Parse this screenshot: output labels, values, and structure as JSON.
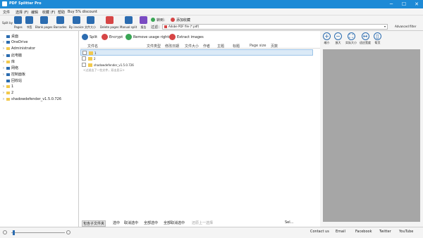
{
  "window": {
    "title": "PDF Splitter Pro",
    "minimize": "─",
    "maximize": "☐",
    "close": "✕"
  },
  "menu": [
    "文件",
    "选择 (F)",
    "编辑",
    "收藏 (F)",
    "帮助",
    "Buy 5% discount"
  ],
  "toolbar": {
    "split_by": "Split by",
    "buttons": [
      {
        "label": "Pages",
        "color": "#2b6cb0"
      },
      {
        "label": "书签",
        "color": "#2b6cb0"
      },
      {
        "label": "Blank pages",
        "color": "#2b6cb0"
      },
      {
        "label": "Barcodes",
        "color": "#2b6cb0"
      },
      {
        "label": "By invoice",
        "color": "#2b6cb0"
      },
      {
        "label": "文件大小",
        "color": "#2b6cb0"
      },
      {
        "label": "Delete pages",
        "color": "#d64545"
      },
      {
        "label": "Manual split",
        "color": "#2b6cb0"
      },
      {
        "label": "报告",
        "color": "#7a4bc2"
      }
    ],
    "goto_label": "转到：",
    "add_fav_label": "添加收藏",
    "filter_label": "过滤：",
    "filter_value": "Adobe PDF file (*.pdf)",
    "advanced_filter": "Advanced filter"
  },
  "tree": [
    {
      "label": "桌面",
      "arrow": "",
      "color": "#2b6cb0"
    },
    {
      "label": "OneDrive",
      "arrow": "›",
      "color": "#2b6cb0"
    },
    {
      "label": "Administrator",
      "arrow": "›",
      "color": "#f2c94c"
    },
    {
      "label": "此电脑",
      "arrow": "›",
      "color": "#2b6cb0"
    },
    {
      "label": "库",
      "arrow": "›",
      "color": "#f2c94c"
    },
    {
      "label": "网络",
      "arrow": "›",
      "color": "#2b6cb0"
    },
    {
      "label": "控制面板",
      "arrow": "›",
      "color": "#2b6cb0"
    },
    {
      "label": "回收站",
      "arrow": "",
      "color": "#2b6cb0"
    },
    {
      "label": "1",
      "arrow": "›",
      "color": "#f2c94c"
    },
    {
      "label": "2",
      "arrow": "›",
      "color": "#f2c94c"
    },
    {
      "label": "shadowdefender_v1.5.0.726",
      "arrow": "›",
      "color": "#f2c94c"
    }
  ],
  "actions": [
    {
      "label": "Split",
      "color": "#2b6cb0"
    },
    {
      "label": "Encrypt",
      "color": "#d64545"
    },
    {
      "label": "Remove usage rights",
      "color": "#3aa655"
    },
    {
      "label": "Extract images",
      "color": "#d64545"
    }
  ],
  "columns": [
    "文件名",
    "文件类型",
    "修改日期",
    "文件大小",
    "作者",
    "主题",
    "标题",
    "Page size",
    "页数"
  ],
  "files": [
    {
      "name": "1",
      "selected": true
    },
    {
      "name": "2",
      "selected": false
    },
    {
      "name": "shadowdefender_v1.5.0.726",
      "selected": false
    }
  ],
  "hint": "<过滤出了一些文件，双击显示>",
  "bottom": [
    "包含子文件夹",
    "选中",
    "取消选中",
    "全部选中",
    "全部取消选中",
    "还原上一选择"
  ],
  "bottom_right": "Sel...",
  "preview_tools": [
    "缩小",
    "放大",
    "实际大小",
    "适应宽度",
    "帮页"
  ],
  "status": [
    "Contact us",
    "Email",
    "Facebook",
    "Twitter",
    "YouTube"
  ]
}
